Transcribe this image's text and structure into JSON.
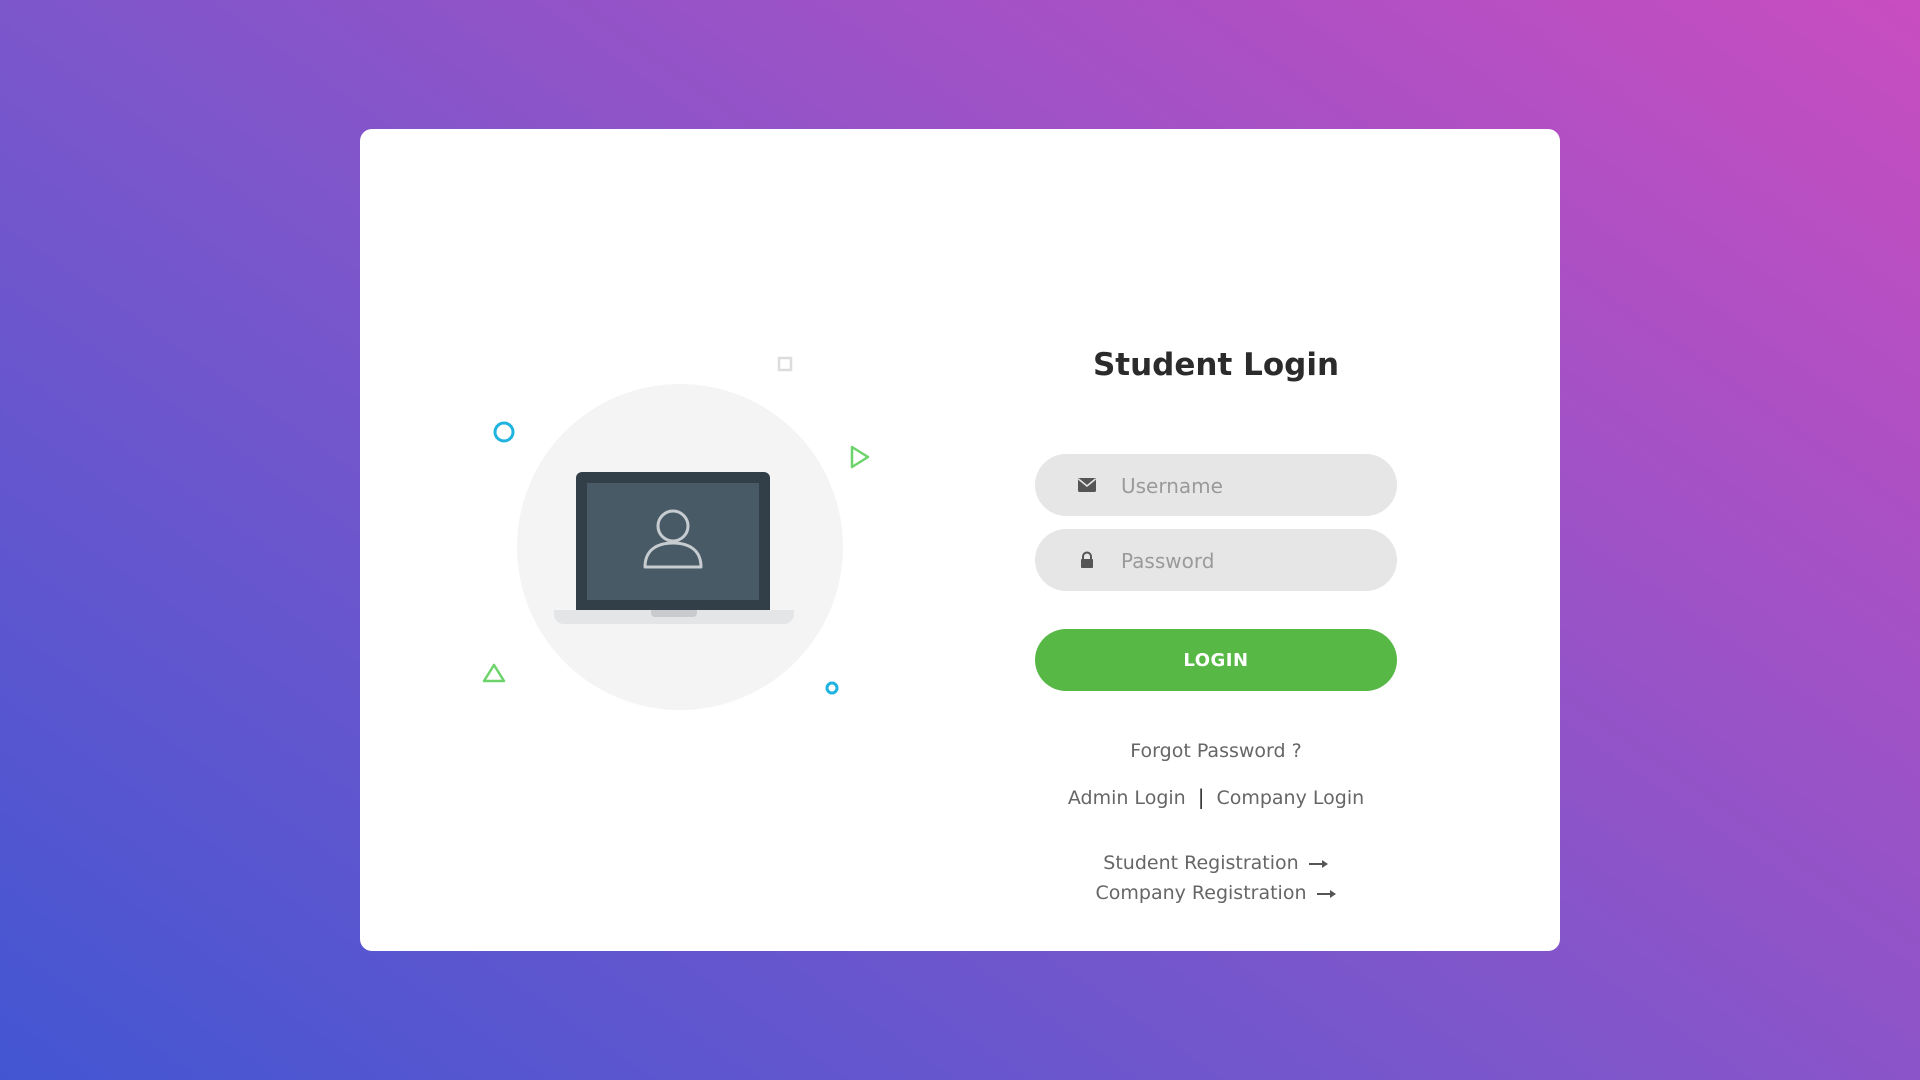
{
  "login": {
    "title": "Student Login",
    "username_placeholder": "Username",
    "password_placeholder": "Password",
    "login_button": "LOGIN",
    "forgot_password": "Forgot Password ?",
    "admin_login": "Admin Login",
    "separator": "|",
    "company_login": "Company Login",
    "student_registration": "Student Registration",
    "company_registration": "Company Registration"
  },
  "icons": {
    "username": "envelope-icon",
    "password": "lock-icon",
    "registration_arrow": "arrow-right-icon",
    "illustration": "laptop-user-icon"
  },
  "colors": {
    "login_button": "#57b846",
    "field_background": "#e6e6e6",
    "accent_blue": "#1fb3e0",
    "accent_green": "#6dd36b"
  }
}
